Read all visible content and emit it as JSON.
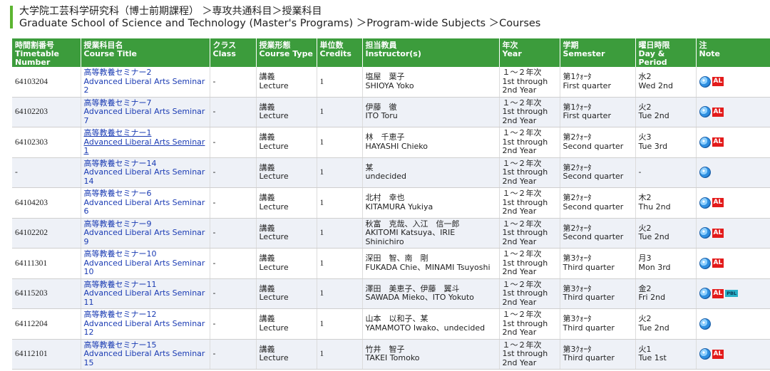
{
  "breadcrumb": {
    "line1": "大学院工芸科学研究科（博士前期課程） ＞専攻共通科目＞授業科目",
    "line2": "Graduate School of Science and Technology (Master's Programs) ＞Program-wide Subjects ＞Courses"
  },
  "headers": [
    {
      "ja": "時間割番号",
      "en": "Timetable Number"
    },
    {
      "ja": "授業科目名",
      "en": "Course Title"
    },
    {
      "ja": "クラス",
      "en": "Class"
    },
    {
      "ja": "授業形態",
      "en": "Course Type"
    },
    {
      "ja": "単位数",
      "en": "Credits"
    },
    {
      "ja": "担当教員",
      "en": "Instructor(s)"
    },
    {
      "ja": "年次",
      "en": "Year"
    },
    {
      "ja": "学期",
      "en": "Semester"
    },
    {
      "ja": "曜日時限",
      "en": "Day & Period"
    },
    {
      "ja": "注",
      "en": "Note"
    }
  ],
  "rows": [
    {
      "num": "64103204",
      "title_ja": "高等教養セミナー2",
      "title_en": "Advanced Liberal Arts Seminar 2",
      "class": "-",
      "type_ja": "講義",
      "type_en": "Lecture",
      "credits": "1",
      "instr_ja": "塩屋　葉子",
      "instr_en": "SHIOYA Yoko",
      "year1": "１～２年次",
      "year2": "1st through",
      "year3": "2nd Year",
      "sem_ja": "第1ｸｫｰﾀ",
      "sem_en": "First quarter",
      "day_ja": "水2",
      "day_en": "Wed 2nd",
      "notes": [
        "globe",
        "AL"
      ]
    },
    {
      "num": "64102203",
      "title_ja": "高等教養セミナー7",
      "title_en": "Advanced Liberal Arts Seminar 7",
      "class": "-",
      "type_ja": "講義",
      "type_en": "Lecture",
      "credits": "1",
      "instr_ja": "伊藤　徹",
      "instr_en": "ITO Toru",
      "year1": "１～２年次",
      "year2": "1st through",
      "year3": "2nd Year",
      "sem_ja": "第1ｸｫｰﾀ",
      "sem_en": "First quarter",
      "day_ja": "火2",
      "day_en": "Tue 2nd",
      "notes": [
        "globe",
        "AL"
      ]
    },
    {
      "num": "64102303",
      "title_ja": "高等教養セミナー1",
      "title_en": "Advanced Liberal Arts Seminar 1",
      "class": "-",
      "type_ja": "講義",
      "type_en": "Lecture",
      "credits": "1",
      "instr_ja": "林　千恵子",
      "instr_en": "HAYASHI Chieko",
      "year1": "１～２年次",
      "year2": "1st through",
      "year3": "2nd Year",
      "sem_ja": "第2ｸｫｰﾀ",
      "sem_en": "Second quarter",
      "day_ja": "火3",
      "day_en": "Tue 3rd",
      "notes": [
        "globe",
        "AL"
      ]
    },
    {
      "num": "-",
      "title_ja": "高等教養セミナー14",
      "title_en": "Advanced Liberal Arts Seminar 14",
      "class": "-",
      "type_ja": "講義",
      "type_en": "Lecture",
      "credits": "1",
      "instr_ja": "某",
      "instr_en": "undecided",
      "year1": "１～２年次",
      "year2": "1st through",
      "year3": "2nd Year",
      "sem_ja": "第2ｸｫｰﾀ",
      "sem_en": "Second quarter",
      "day_ja": "-",
      "day_en": "",
      "notes": [
        "globe"
      ]
    },
    {
      "num": "64104203",
      "title_ja": "高等教養セミナー6",
      "title_en": "Advanced Liberal Arts Seminar 6",
      "class": "-",
      "type_ja": "講義",
      "type_en": "Lecture",
      "credits": "1",
      "instr_ja": "北村　幸也",
      "instr_en": "KITAMURA Yukiya",
      "year1": "１～２年次",
      "year2": "1st through",
      "year3": "2nd Year",
      "sem_ja": "第2ｸｫｰﾀ",
      "sem_en": "Second quarter",
      "day_ja": "木2",
      "day_en": "Thu 2nd",
      "notes": [
        "globe",
        "AL"
      ]
    },
    {
      "num": "64102202",
      "title_ja": "高等教養セミナー9",
      "title_en": "Advanced Liberal Arts Seminar 9",
      "class": "-",
      "type_ja": "講義",
      "type_en": "Lecture",
      "credits": "1",
      "instr_ja": "秋富　克哉、入江　信一郎",
      "instr_en": "AKITOMI Katsuya、IRIE Shinichiro",
      "year1": "１～２年次",
      "year2": "1st through",
      "year3": "2nd Year",
      "sem_ja": "第2ｸｫｰﾀ",
      "sem_en": "Second quarter",
      "day_ja": "火2",
      "day_en": "Tue 2nd",
      "notes": [
        "globe",
        "AL"
      ]
    },
    {
      "num": "64111301",
      "title_ja": "高等教養セミナー10",
      "title_en": "Advanced Liberal Arts Seminar 10",
      "class": "-",
      "type_ja": "講義",
      "type_en": "Lecture",
      "credits": "1",
      "instr_ja": "深田　智、南　剛",
      "instr_en": "FUKADA Chie、MINAMI Tsuyoshi",
      "year1": "１～２年次",
      "year2": "1st through",
      "year3": "2nd Year",
      "sem_ja": "第3ｸｫｰﾀ",
      "sem_en": "Third quarter",
      "day_ja": "月3",
      "day_en": "Mon 3rd",
      "notes": [
        "globe",
        "AL"
      ]
    },
    {
      "num": "64115203",
      "title_ja": "高等教養セミナー11",
      "title_en": "Advanced Liberal Arts Seminar 11",
      "class": "-",
      "type_ja": "講義",
      "type_en": "Lecture",
      "credits": "1",
      "instr_ja": "澤田　美恵子、伊藤　翼斗",
      "instr_en": "SAWADA Mieko、ITO Yokuto",
      "year1": "１～２年次",
      "year2": "1st through",
      "year3": "2nd Year",
      "sem_ja": "第3ｸｫｰﾀ",
      "sem_en": "Third quarter",
      "day_ja": "金2",
      "day_en": "Fri 2nd",
      "notes": [
        "globe",
        "AL",
        "PBL"
      ]
    },
    {
      "num": "64112204",
      "title_ja": "高等教養セミナー12",
      "title_en": "Advanced Liberal Arts Seminar 12",
      "class": "-",
      "type_ja": "講義",
      "type_en": "Lecture",
      "credits": "1",
      "instr_ja": "山本　以和子、某",
      "instr_en": "YAMAMOTO Iwako、undecided",
      "year1": "１～２年次",
      "year2": "1st through",
      "year3": "2nd Year",
      "sem_ja": "第3ｸｫｰﾀ",
      "sem_en": "Third quarter",
      "day_ja": "火2",
      "day_en": "Tue 2nd",
      "notes": [
        "globe"
      ]
    },
    {
      "num": "64112101",
      "title_ja": "高等教養セミナー15",
      "title_en": "Advanced Liberal Arts Seminar 15",
      "class": "-",
      "type_ja": "講義",
      "type_en": "Lecture",
      "credits": "1",
      "instr_ja": "竹井　智子",
      "instr_en": "TAKEI Tomoko",
      "year1": "１～２年次",
      "year2": "1st through",
      "year3": "2nd Year",
      "sem_ja": "第3ｸｫｰﾀ",
      "sem_en": "Third quarter",
      "day_ja": "火1",
      "day_en": "Tue 1st",
      "notes": [
        "globe",
        "AL"
      ]
    }
  ],
  "badges": {
    "al": "AL",
    "pbl": "PBL"
  }
}
